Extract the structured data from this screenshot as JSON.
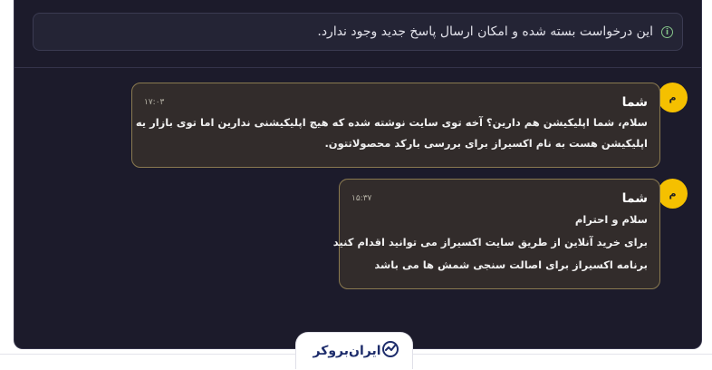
{
  "notice": {
    "icon": "info-icon",
    "text": "این درخواست بسته شده و امکان ارسال پاسخ جدید وجود ندارد."
  },
  "messages": [
    {
      "avatar": "م",
      "sender": "شما",
      "time": "۱۷:۰۳",
      "lines": [
        "سلام، شما اپلیکیشن هم دارین؟ آخه توی سایت نوشته شده که هیچ اپلیکیشنی ندارین اما توی بازار یه",
        "اپلیکیشن هست به نام اکسیراز برای بررسی بارکد محصولاتتون."
      ]
    },
    {
      "avatar": "م",
      "sender": "شما",
      "time": "۱۵:۳۷",
      "lines": [
        "سلام و احترام",
        "برای خرید آنلاین از طریق سایت اکسیراز می توانید اقدام کنید",
        "برنامه اکسیراز برای اصالت سنجی شمش ها می باشد"
      ]
    }
  ],
  "footer": {
    "logo_text": "ایران‌بروکر",
    "logo_icon": "chart-check-icon",
    "accent": "#1d2c6b"
  },
  "colors": {
    "panel": "#1c1b2b",
    "avatar": "#f5c000",
    "bubble_border": "#8a7a50"
  }
}
